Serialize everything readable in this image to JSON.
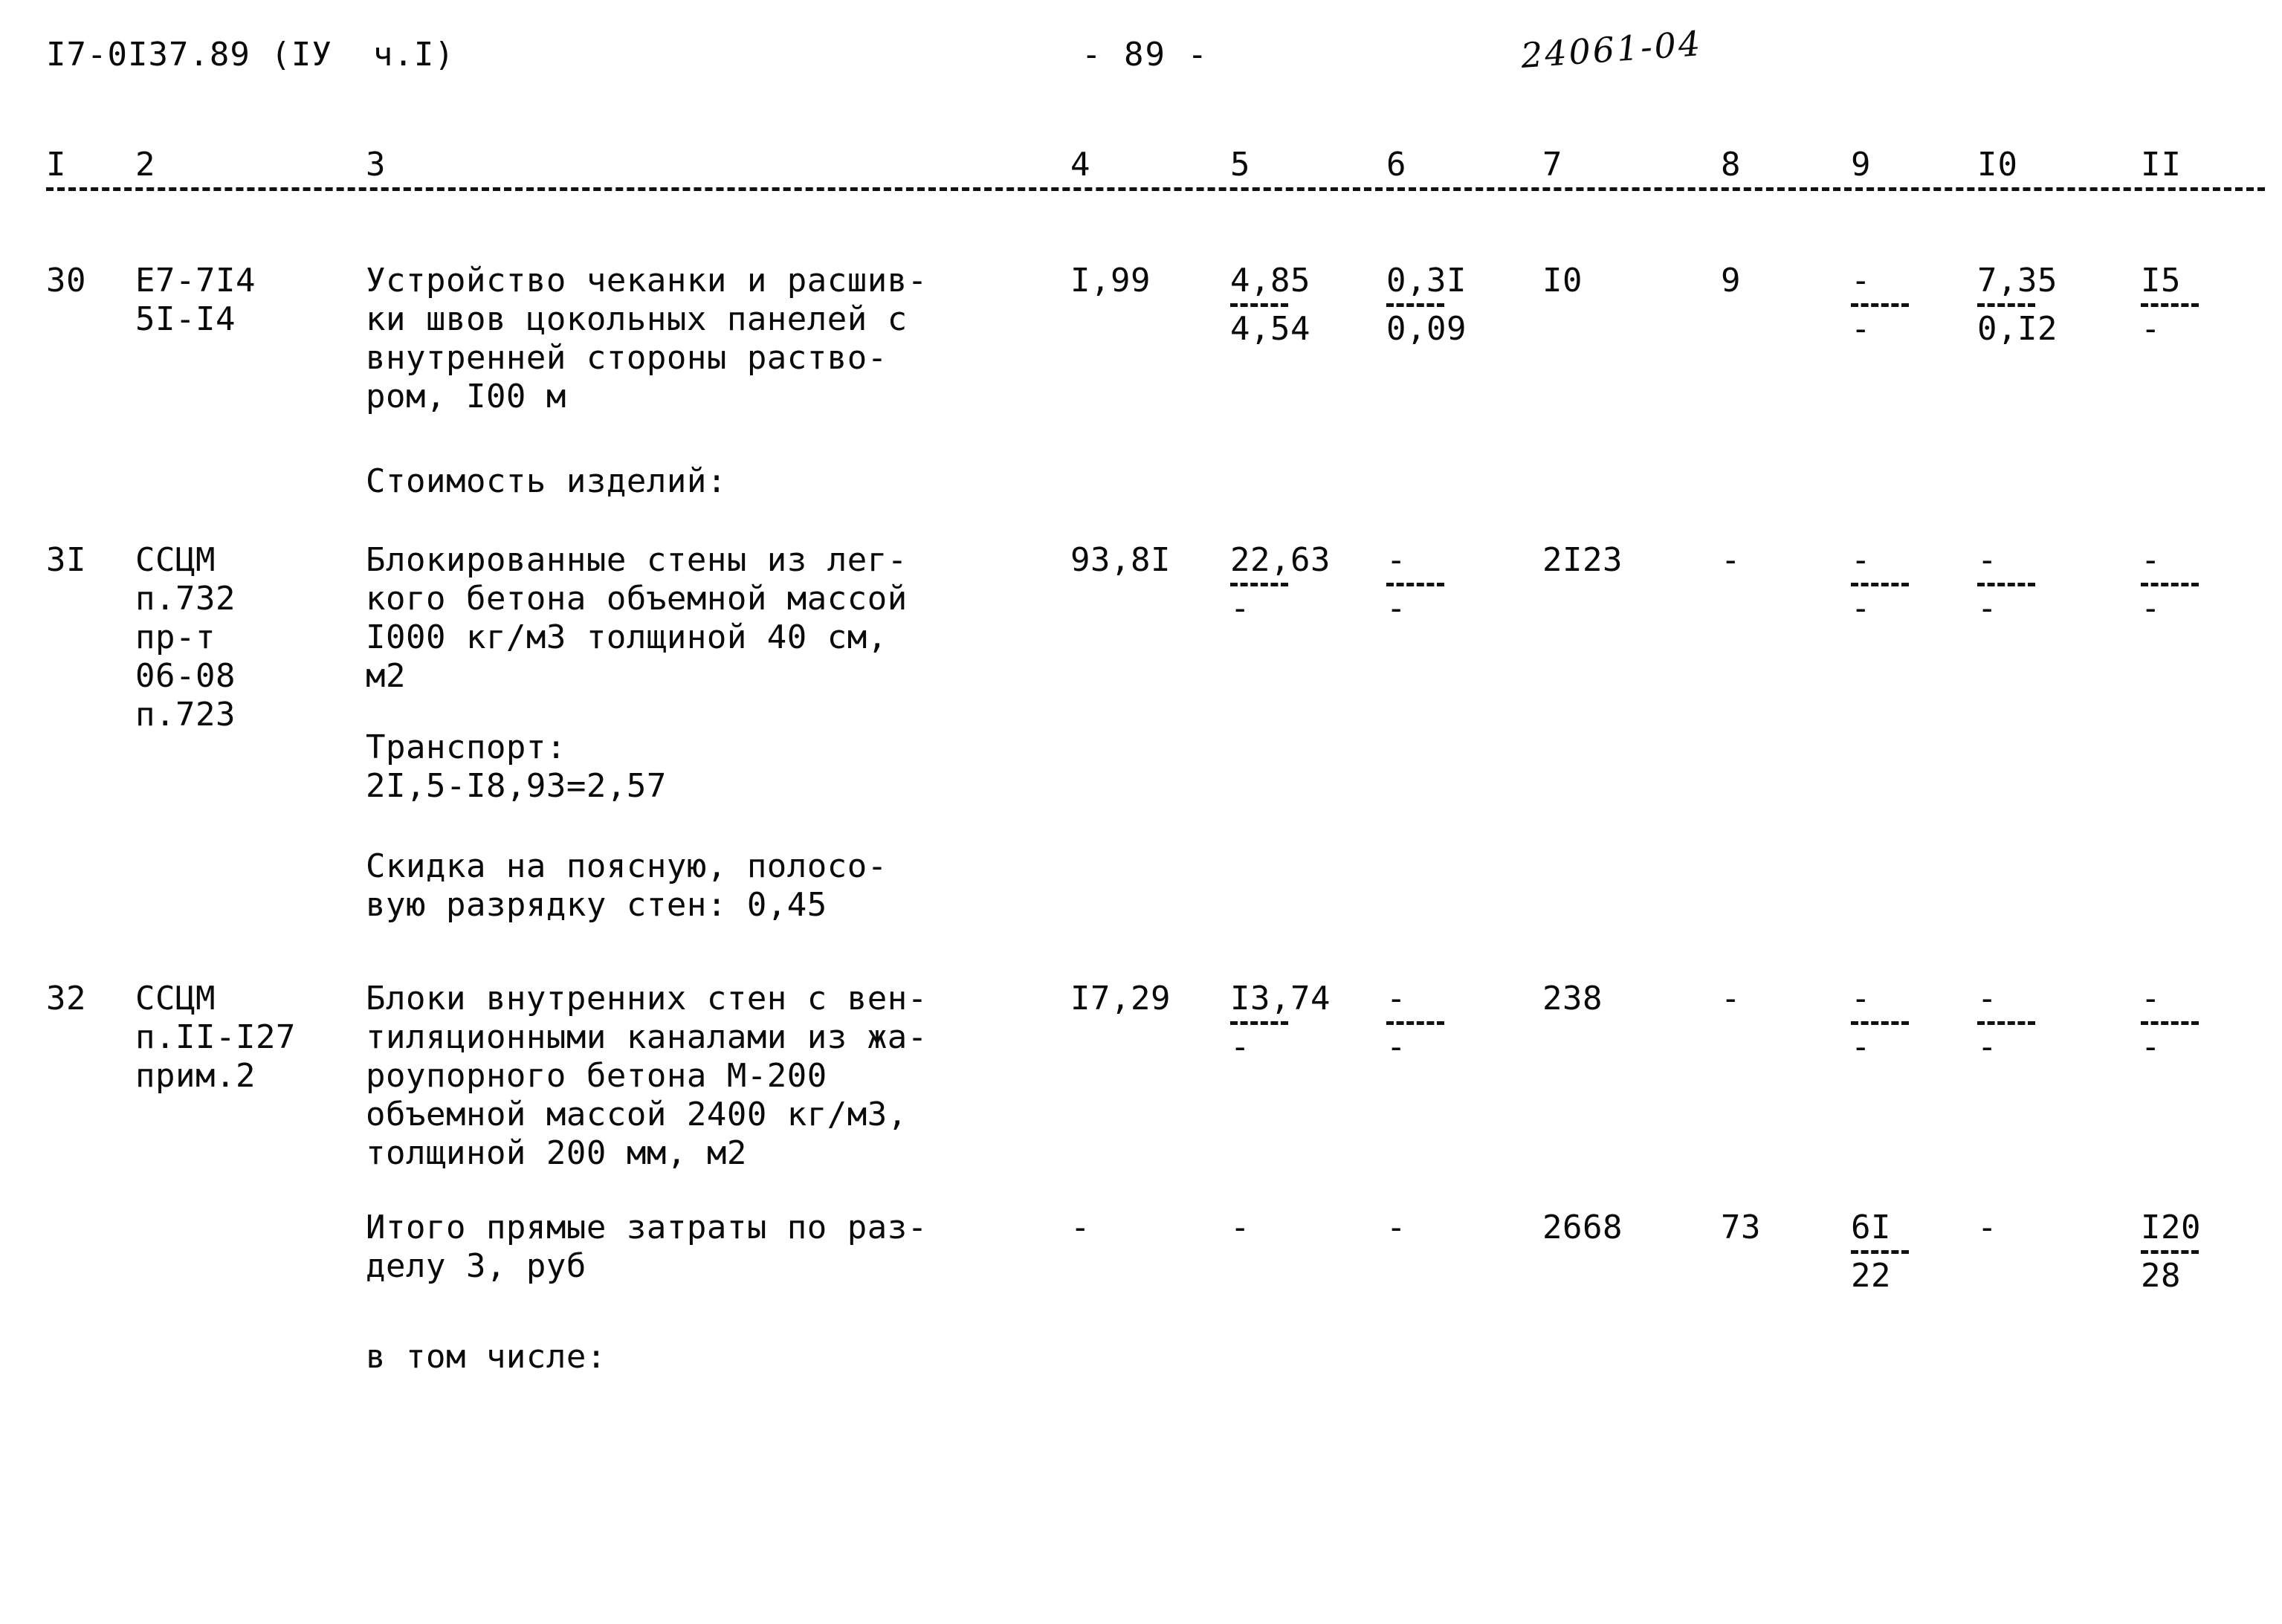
{
  "header": {
    "doc_code": "I7-0I37.89 (IУ  ч.I)",
    "page_marker": "- 89 -",
    "handwritten_number": "24061-04"
  },
  "table": {
    "column_numbers": [
      "I",
      "2",
      "3",
      "4",
      "5",
      "6",
      "7",
      "8",
      "9",
      "I0",
      "II"
    ],
    "rows": [
      {
        "no": "30",
        "code_lines": [
          "Е7-7I4",
          "5I-I4"
        ],
        "description_lines": [
          "Устройство чеканки и расшив-",
          "ки швов цокольных панелей с",
          "внутренней стороны раство-",
          "ром, I00 м"
        ],
        "c4": "I,99",
        "c5_top": "4,85",
        "c5_bottom": "4,54",
        "c6_top": "0,3I",
        "c6_bottom": "0,09",
        "c7": "I0",
        "c8": "9",
        "c9_top": "-",
        "c9_bottom": "-",
        "c10_top": "7,35",
        "c10_bottom": "0,I2",
        "c11_top": "I5",
        "c11_bottom": "-"
      },
      {
        "no": "3I",
        "code_lines": [
          "ССЦМ",
          "п.732",
          "пр-т",
          "06-08",
          "п.723"
        ],
        "description_lines": [
          "Блокированные стены из лег-",
          "кого бетона объемной массой",
          "I000 кг/м3 толщиной 40 см,",
          "м2"
        ],
        "c4": "93,8I",
        "c5_top": "22,63",
        "c5_bottom": "-",
        "c6_top": "-",
        "c6_bottom": "-",
        "c7": "2I23",
        "c8": "-",
        "c9_top": "-",
        "c9_bottom": "-",
        "c10_top": "-",
        "c10_bottom": "-",
        "c11_top": "-",
        "c11_bottom": "-"
      },
      {
        "no": "32",
        "code_lines": [
          "ССЦМ",
          "п.II-I27",
          "прим.2"
        ],
        "description_lines": [
          "Блоки внутренних стен с вен-",
          "тиляционными каналами из жа-",
          "роупорного бетона М-200",
          "объемной массой 2400 кг/м3,",
          "толщиной 200 мм, м2"
        ],
        "c4": "I7,29",
        "c5_top": "I3,74",
        "c5_bottom": "-",
        "c6_top": "-",
        "c6_bottom": "-",
        "c7": "238",
        "c8": "-",
        "c9_top": "-",
        "c9_bottom": "-",
        "c10_top": "-",
        "c10_bottom": "-",
        "c11_top": "-",
        "c11_bottom": "-"
      }
    ],
    "total_row": {
      "description_lines": [
        "Итого прямые затраты по раз-",
        "делу 3, руб"
      ],
      "c4": "-",
      "c5": "-",
      "c6": "-",
      "c7": "2668",
      "c8": "73",
      "c9_top": "6I",
      "c9_bottom": "22",
      "c10": "-",
      "c11_top": "I20",
      "c11_bottom": "28"
    }
  },
  "notes": {
    "cost_of_products": "Стоимость изделий:",
    "transport_label": "Транспорт:",
    "transport_formula": "2I,5-I8,93=2,57",
    "discount_line1": "Скидка на поясную, полосо-",
    "discount_line2": "вую разрядку стен: 0,45",
    "including": "в том числе:"
  }
}
